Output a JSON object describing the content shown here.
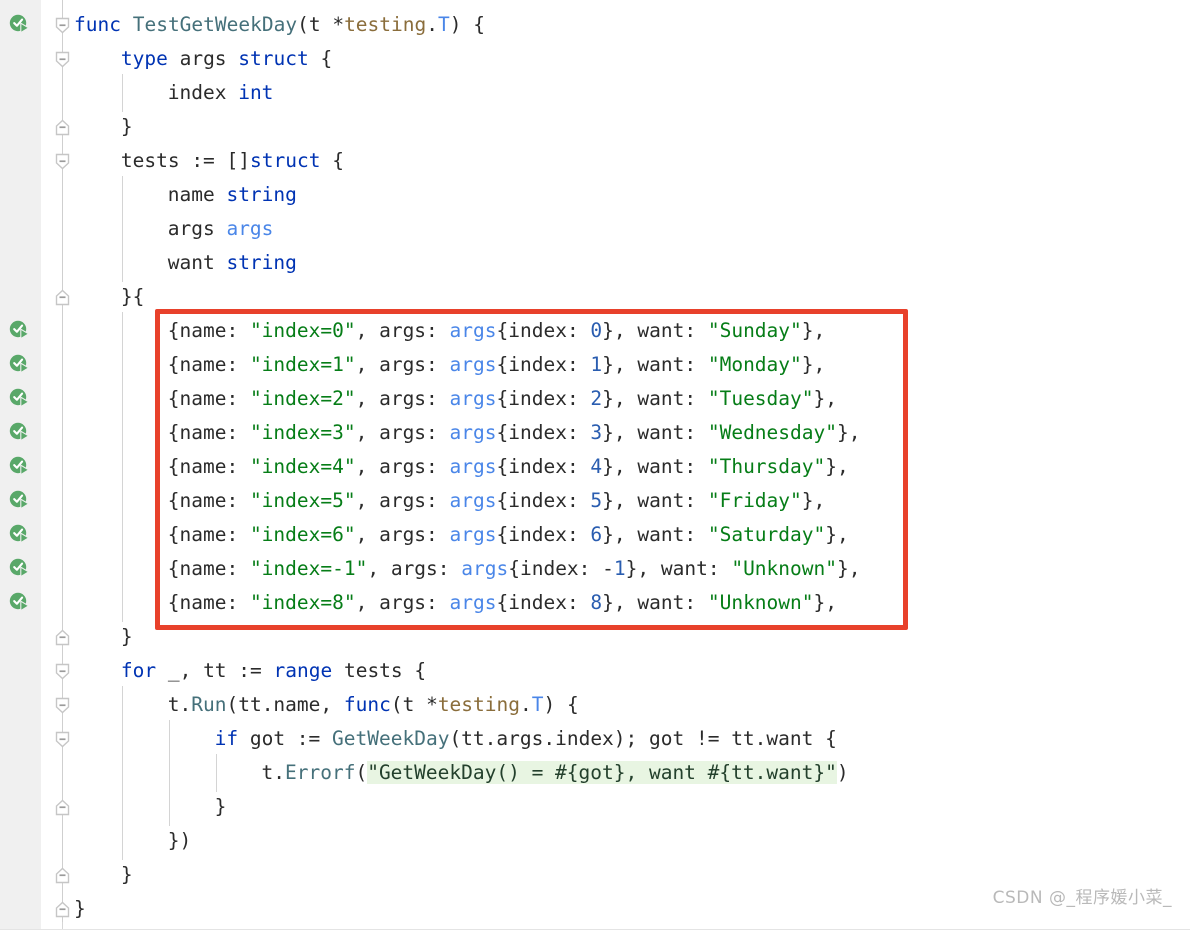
{
  "app": {
    "kind": "code-editor",
    "language": "Go",
    "background": "#ffffff",
    "gutter_background": "#f0f0f0"
  },
  "colors": {
    "keyword": "#0033b3",
    "function": "#45707a",
    "package": "#8a6d3b",
    "type": "#4a86e8",
    "number": "#2a5db0",
    "string": "#067d17",
    "plain": "#2b2b2b",
    "format_string_bg": "#e8f5e2",
    "annotation_box": "#e8412b",
    "run_icon_green": "#59a869",
    "watermark": "#b9b9b9"
  },
  "gutter": {
    "run_icon_name": "run-test-success-icon",
    "run_icon_tooltip": "Run Test",
    "run_icon_rows": [
      0,
      9,
      10,
      11,
      12,
      13,
      14,
      15,
      16,
      17
    ],
    "fold_markers": [
      {
        "row": 0,
        "state": "expanded-start"
      },
      {
        "row": 1,
        "state": "expanded-start"
      },
      {
        "row": 3,
        "state": "expanded-end"
      },
      {
        "row": 4,
        "state": "expanded-start"
      },
      {
        "row": 8,
        "state": "expanded-end"
      },
      {
        "row": 18,
        "state": "expanded-end"
      },
      {
        "row": 19,
        "state": "expanded-start"
      },
      {
        "row": 20,
        "state": "expanded-start"
      },
      {
        "row": 21,
        "state": "expanded-start"
      },
      {
        "row": 23,
        "state": "expanded-end"
      },
      {
        "row": 25,
        "state": "expanded-end"
      },
      {
        "row": 26,
        "state": "expanded-end"
      }
    ]
  },
  "annotation": {
    "name": "red-highlight-box",
    "color": "#e8412b",
    "covers_rows": "9-17",
    "description": "Red rectangle highlighting the test case table literal"
  },
  "watermark": {
    "text": "CSDN @_程序媛小菜_"
  },
  "code": {
    "line_height": 34,
    "font_size": 19.5,
    "lines": [
      {
        "row": 0,
        "indent": 0,
        "tokens": [
          {
            "t": "func",
            "c": "kw"
          },
          {
            "t": " ",
            "c": "plain"
          },
          {
            "t": "TestGetWeekDay",
            "c": "fn"
          },
          {
            "t": "(t *",
            "c": "plain"
          },
          {
            "t": "testing",
            "c": "pkg"
          },
          {
            "t": ".",
            "c": "plain"
          },
          {
            "t": "T",
            "c": "typ"
          },
          {
            "t": ") {",
            "c": "plain"
          }
        ]
      },
      {
        "row": 1,
        "indent": 1,
        "tokens": [
          {
            "t": "type",
            "c": "kw"
          },
          {
            "t": " args ",
            "c": "plain"
          },
          {
            "t": "struct",
            "c": "kw"
          },
          {
            "t": " {",
            "c": "plain"
          }
        ]
      },
      {
        "row": 2,
        "indent": 2,
        "tokens": [
          {
            "t": "index ",
            "c": "plain"
          },
          {
            "t": "int",
            "c": "kw"
          }
        ]
      },
      {
        "row": 3,
        "indent": 1,
        "tokens": [
          {
            "t": "}",
            "c": "plain"
          }
        ]
      },
      {
        "row": 4,
        "indent": 1,
        "tokens": [
          {
            "t": "tests := []",
            "c": "plain"
          },
          {
            "t": "struct",
            "c": "kw"
          },
          {
            "t": " {",
            "c": "plain"
          }
        ]
      },
      {
        "row": 5,
        "indent": 2,
        "tokens": [
          {
            "t": "name ",
            "c": "plain"
          },
          {
            "t": "string",
            "c": "kw"
          }
        ]
      },
      {
        "row": 6,
        "indent": 2,
        "tokens": [
          {
            "t": "args ",
            "c": "plain"
          },
          {
            "t": "args",
            "c": "typ"
          }
        ]
      },
      {
        "row": 7,
        "indent": 2,
        "tokens": [
          {
            "t": "want ",
            "c": "plain"
          },
          {
            "t": "string",
            "c": "kw"
          }
        ]
      },
      {
        "row": 8,
        "indent": 1,
        "tokens": [
          {
            "t": "}{",
            "c": "plain"
          }
        ]
      },
      {
        "row": 9,
        "indent": 2,
        "tokens": [
          {
            "t": "{name: ",
            "c": "plain"
          },
          {
            "t": "\"index=0\"",
            "c": "str"
          },
          {
            "t": ", args: ",
            "c": "plain"
          },
          {
            "t": "args",
            "c": "typ"
          },
          {
            "t": "{index: ",
            "c": "plain"
          },
          {
            "t": "0",
            "c": "num"
          },
          {
            "t": "}, want: ",
            "c": "plain"
          },
          {
            "t": "\"Sunday\"",
            "c": "str"
          },
          {
            "t": "},",
            "c": "plain"
          }
        ]
      },
      {
        "row": 10,
        "indent": 2,
        "tokens": [
          {
            "t": "{name: ",
            "c": "plain"
          },
          {
            "t": "\"index=1\"",
            "c": "str"
          },
          {
            "t": ", args: ",
            "c": "plain"
          },
          {
            "t": "args",
            "c": "typ"
          },
          {
            "t": "{index: ",
            "c": "plain"
          },
          {
            "t": "1",
            "c": "num"
          },
          {
            "t": "}, want: ",
            "c": "plain"
          },
          {
            "t": "\"Monday\"",
            "c": "str"
          },
          {
            "t": "},",
            "c": "plain"
          }
        ]
      },
      {
        "row": 11,
        "indent": 2,
        "tokens": [
          {
            "t": "{name: ",
            "c": "plain"
          },
          {
            "t": "\"index=2\"",
            "c": "str"
          },
          {
            "t": ", args: ",
            "c": "plain"
          },
          {
            "t": "args",
            "c": "typ"
          },
          {
            "t": "{index: ",
            "c": "plain"
          },
          {
            "t": "2",
            "c": "num"
          },
          {
            "t": "}, want: ",
            "c": "plain"
          },
          {
            "t": "\"Tuesday\"",
            "c": "str"
          },
          {
            "t": "},",
            "c": "plain"
          }
        ]
      },
      {
        "row": 12,
        "indent": 2,
        "tokens": [
          {
            "t": "{name: ",
            "c": "plain"
          },
          {
            "t": "\"index=3\"",
            "c": "str"
          },
          {
            "t": ", args: ",
            "c": "plain"
          },
          {
            "t": "args",
            "c": "typ"
          },
          {
            "t": "{index: ",
            "c": "plain"
          },
          {
            "t": "3",
            "c": "num"
          },
          {
            "t": "}, want: ",
            "c": "plain"
          },
          {
            "t": "\"Wednesday\"",
            "c": "str"
          },
          {
            "t": "},",
            "c": "plain"
          }
        ]
      },
      {
        "row": 13,
        "indent": 2,
        "tokens": [
          {
            "t": "{name: ",
            "c": "plain"
          },
          {
            "t": "\"index=4\"",
            "c": "str"
          },
          {
            "t": ", args: ",
            "c": "plain"
          },
          {
            "t": "args",
            "c": "typ"
          },
          {
            "t": "{index: ",
            "c": "plain"
          },
          {
            "t": "4",
            "c": "num"
          },
          {
            "t": "}, want: ",
            "c": "plain"
          },
          {
            "t": "\"Thursday\"",
            "c": "str"
          },
          {
            "t": "},",
            "c": "plain"
          }
        ]
      },
      {
        "row": 14,
        "indent": 2,
        "tokens": [
          {
            "t": "{name: ",
            "c": "plain"
          },
          {
            "t": "\"index=5\"",
            "c": "str"
          },
          {
            "t": ", args: ",
            "c": "plain"
          },
          {
            "t": "args",
            "c": "typ"
          },
          {
            "t": "{index: ",
            "c": "plain"
          },
          {
            "t": "5",
            "c": "num"
          },
          {
            "t": "}, want: ",
            "c": "plain"
          },
          {
            "t": "\"Friday\"",
            "c": "str"
          },
          {
            "t": "},",
            "c": "plain"
          }
        ]
      },
      {
        "row": 15,
        "indent": 2,
        "tokens": [
          {
            "t": "{name: ",
            "c": "plain"
          },
          {
            "t": "\"index=6\"",
            "c": "str"
          },
          {
            "t": ", args: ",
            "c": "plain"
          },
          {
            "t": "args",
            "c": "typ"
          },
          {
            "t": "{index: ",
            "c": "plain"
          },
          {
            "t": "6",
            "c": "num"
          },
          {
            "t": "}, want: ",
            "c": "plain"
          },
          {
            "t": "\"Saturday\"",
            "c": "str"
          },
          {
            "t": "},",
            "c": "plain"
          }
        ]
      },
      {
        "row": 16,
        "indent": 2,
        "tokens": [
          {
            "t": "{name: ",
            "c": "plain"
          },
          {
            "t": "\"index=-1\"",
            "c": "str"
          },
          {
            "t": ", args: ",
            "c": "plain"
          },
          {
            "t": "args",
            "c": "typ"
          },
          {
            "t": "{index: -",
            "c": "plain"
          },
          {
            "t": "1",
            "c": "num"
          },
          {
            "t": "}, want: ",
            "c": "plain"
          },
          {
            "t": "\"Unknown\"",
            "c": "str"
          },
          {
            "t": "},",
            "c": "plain"
          }
        ]
      },
      {
        "row": 17,
        "indent": 2,
        "tokens": [
          {
            "t": "{name: ",
            "c": "plain"
          },
          {
            "t": "\"index=8\"",
            "c": "str"
          },
          {
            "t": ", args: ",
            "c": "plain"
          },
          {
            "t": "args",
            "c": "typ"
          },
          {
            "t": "{index: ",
            "c": "plain"
          },
          {
            "t": "8",
            "c": "num"
          },
          {
            "t": "}, want: ",
            "c": "plain"
          },
          {
            "t": "\"Unknown\"",
            "c": "str"
          },
          {
            "t": "},",
            "c": "plain"
          }
        ]
      },
      {
        "row": 18,
        "indent": 1,
        "tokens": [
          {
            "t": "}",
            "c": "plain"
          }
        ]
      },
      {
        "row": 19,
        "indent": 1,
        "tokens": [
          {
            "t": "for",
            "c": "kw"
          },
          {
            "t": " _, tt := ",
            "c": "plain"
          },
          {
            "t": "range",
            "c": "kw"
          },
          {
            "t": " tests {",
            "c": "plain"
          }
        ]
      },
      {
        "row": 20,
        "indent": 2,
        "tokens": [
          {
            "t": "t.",
            "c": "plain"
          },
          {
            "t": "Run",
            "c": "fn"
          },
          {
            "t": "(tt.name, ",
            "c": "plain"
          },
          {
            "t": "func",
            "c": "kw"
          },
          {
            "t": "(t *",
            "c": "plain"
          },
          {
            "t": "testing",
            "c": "pkg"
          },
          {
            "t": ".",
            "c": "plain"
          },
          {
            "t": "T",
            "c": "typ"
          },
          {
            "t": ") {",
            "c": "plain"
          }
        ]
      },
      {
        "row": 21,
        "indent": 3,
        "tokens": [
          {
            "t": "if",
            "c": "kw"
          },
          {
            "t": " got := ",
            "c": "plain"
          },
          {
            "t": "GetWeekDay",
            "c": "fn"
          },
          {
            "t": "(tt.args.index); got != tt.want {",
            "c": "plain"
          }
        ]
      },
      {
        "row": 22,
        "indent": 4,
        "tokens": [
          {
            "t": "t.",
            "c": "plain"
          },
          {
            "t": "Errorf",
            "c": "fn"
          },
          {
            "t": "(",
            "c": "plain"
          },
          {
            "t": "\"GetWeekDay() = #{got}, want #{tt.want}\"",
            "c": "fstr"
          },
          {
            "t": ")",
            "c": "plain"
          }
        ]
      },
      {
        "row": 23,
        "indent": 3,
        "tokens": [
          {
            "t": "}",
            "c": "plain"
          }
        ]
      },
      {
        "row": 24,
        "indent": 2,
        "tokens": [
          {
            "t": "})",
            "c": "plain"
          }
        ]
      },
      {
        "row": 25,
        "indent": 1,
        "tokens": [
          {
            "t": "}",
            "c": "plain"
          }
        ]
      },
      {
        "row": 26,
        "indent": 0,
        "tokens": [
          {
            "t": "}",
            "c": "plain"
          }
        ]
      }
    ],
    "indent_guides": [
      {
        "level": 2,
        "from_row": 2,
        "to_row": 2
      },
      {
        "level": 2,
        "from_row": 5,
        "to_row": 7
      },
      {
        "level": 2,
        "from_row": 9,
        "to_row": 17
      },
      {
        "level": 2,
        "from_row": 20,
        "to_row": 24
      },
      {
        "level": 3,
        "from_row": 21,
        "to_row": 23
      },
      {
        "level": 4,
        "from_row": 22,
        "to_row": 22
      }
    ]
  }
}
